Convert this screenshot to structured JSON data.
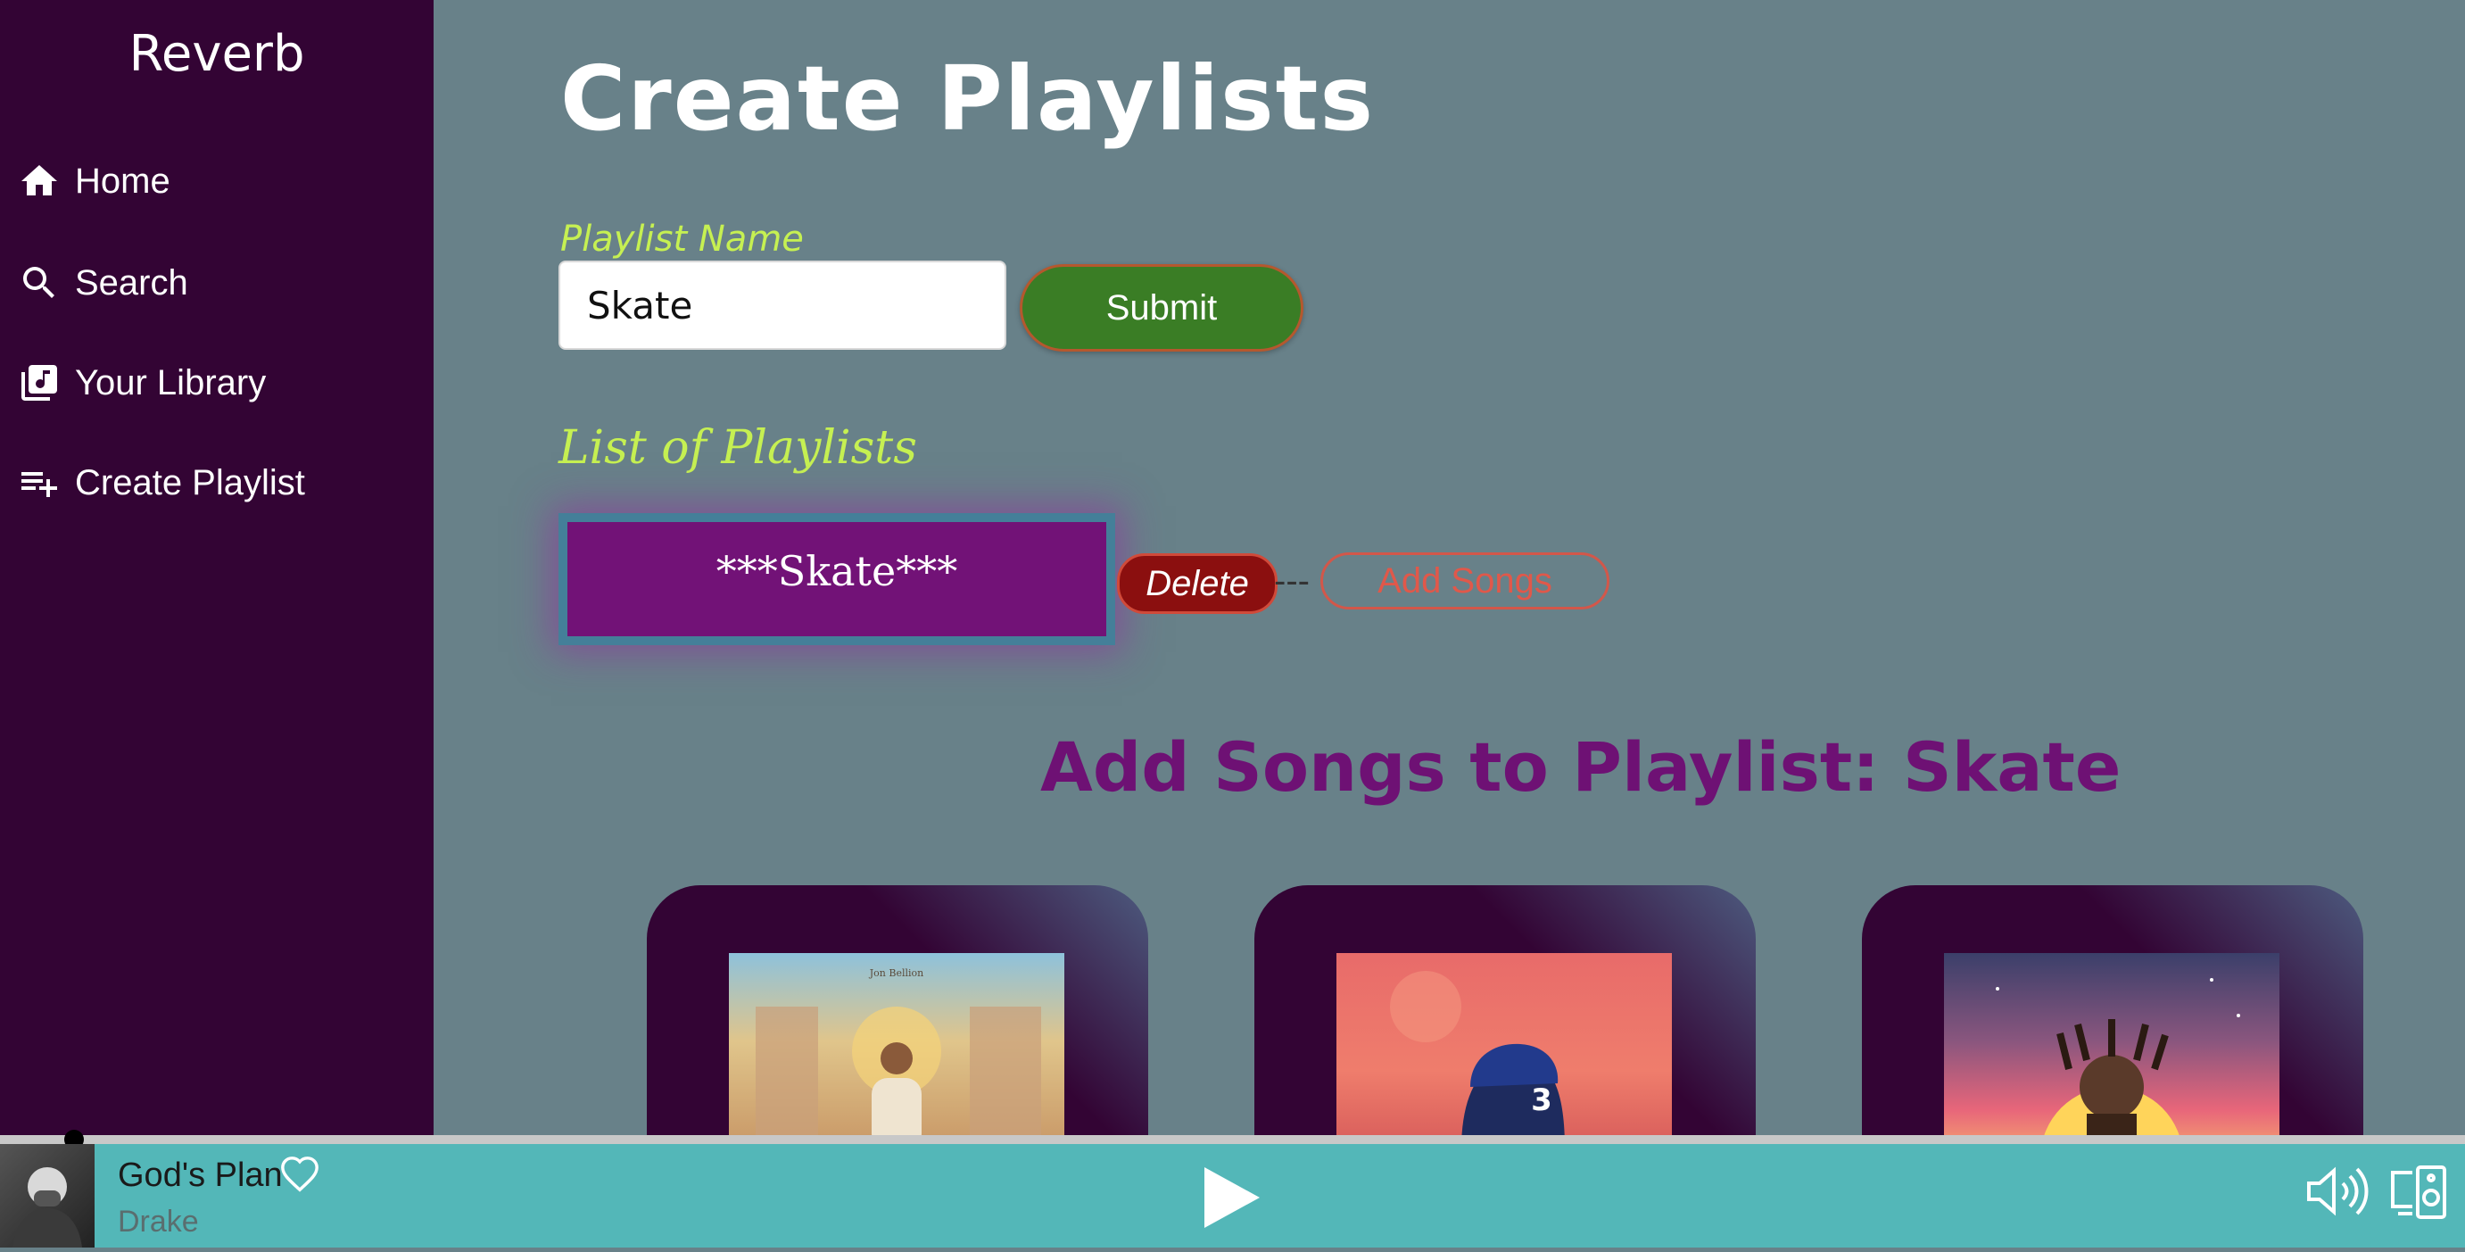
{
  "app": {
    "brand": "Reverb"
  },
  "sidebar": {
    "items": [
      {
        "label": "Home",
        "icon": "home-icon"
      },
      {
        "label": "Search",
        "icon": "search-icon"
      },
      {
        "label": "Your Library",
        "icon": "library-icon"
      },
      {
        "label": "Create Playlist",
        "icon": "playlist-add-icon"
      }
    ]
  },
  "main": {
    "title": "Create Playlists",
    "form": {
      "label": "Playlist Name",
      "input_value": "Skate",
      "submit_label": "Submit"
    },
    "list_heading": "List of Playlists",
    "playlists": [
      {
        "name": "***Skate***",
        "delete_label": "Delete",
        "separator": "---",
        "add_label": "Add Songs"
      }
    ],
    "add_songs_heading": "Add Songs to Playlist: Skate",
    "albums": [
      {
        "art": "album-art-1",
        "overlay_text": "Jon Bellion"
      },
      {
        "art": "album-art-2",
        "overlay_text": "3"
      },
      {
        "art": "album-art-3"
      }
    ]
  },
  "player": {
    "song": "God's Plan",
    "artist": "Drake",
    "progress": 0.03
  },
  "colors": {
    "sidebar_bg": "#330434",
    "main_bg": "#688189",
    "accent_lime": "#c6f052",
    "accent_purple": "#6e1174",
    "player_bg": "#53b7b8",
    "submit_green": "#3a7d25",
    "delete_red": "#8b0f0f"
  }
}
